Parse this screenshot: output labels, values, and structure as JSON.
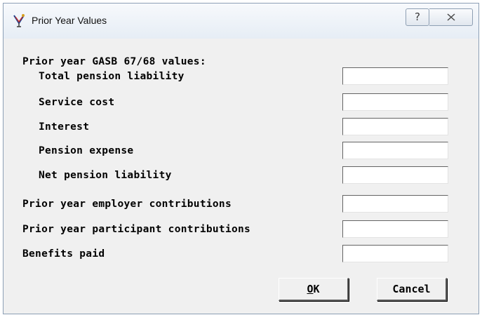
{
  "window": {
    "title": "Prior Year Values",
    "help_glyph": "?",
    "icons": {
      "app": "app-icon",
      "help": "help-icon",
      "close": "close-icon"
    }
  },
  "form": {
    "section_header": "Prior year GASB 67/68 values:",
    "fields": [
      {
        "label": "Total pension liability",
        "value": ""
      },
      {
        "label": "Service cost",
        "value": ""
      },
      {
        "label": "Interest",
        "value": ""
      },
      {
        "label": "Pension expense",
        "value": ""
      },
      {
        "label": "Net pension liability",
        "value": ""
      },
      {
        "label": "Prior year employer contributions",
        "value": ""
      },
      {
        "label": "Prior year participant contributions",
        "value": ""
      },
      {
        "label": "Benefits paid",
        "value": ""
      }
    ]
  },
  "buttons": {
    "ok_mnemonic": "O",
    "ok_rest": "K",
    "cancel": "Cancel"
  }
}
